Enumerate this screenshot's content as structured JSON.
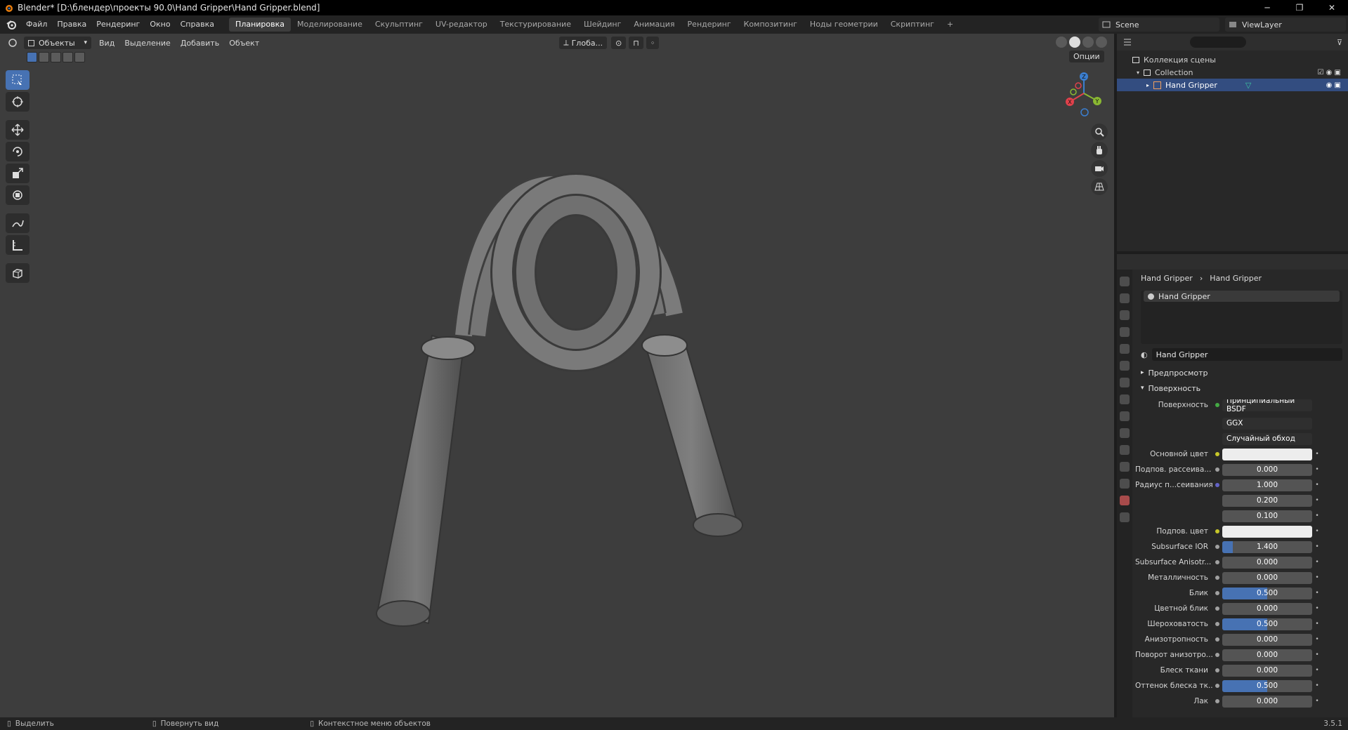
{
  "window": {
    "title": "Blender* [D:\\блендер\\проекты 90.0\\Hand Gripper\\Hand Gripper.blend]",
    "min_label": "─",
    "max_label": "❐",
    "close_label": "✕"
  },
  "menubar": {
    "items": [
      "Файл",
      "Правка",
      "Рендеринг",
      "Окно",
      "Справка"
    ],
    "workspaces": [
      "Планировка",
      "Моделирование",
      "Скульптинг",
      "UV-редактор",
      "Текстурирование",
      "Шейдинг",
      "Анимация",
      "Рендеринг",
      "Композитинг",
      "Ноды геометрии",
      "Скриптинг"
    ],
    "active_workspace": 0,
    "add_tab": "+",
    "scene": "Scene",
    "view_layer": "ViewLayer"
  },
  "viewport": {
    "mode": "Объекты",
    "menus": [
      "Вид",
      "Выделение",
      "Добавить",
      "Объект"
    ],
    "orientation": "Глоба...",
    "options": "Опции",
    "gizmo": {
      "x": "X",
      "y": "Y",
      "z": "Z"
    }
  },
  "outliner": {
    "rows": [
      {
        "label": "Коллекция сцены",
        "depth": 0,
        "selected": false
      },
      {
        "label": "Collection",
        "depth": 1,
        "selected": false
      },
      {
        "label": "Hand Gripper",
        "depth": 2,
        "selected": true
      }
    ]
  },
  "properties": {
    "breadcrumb": [
      "Hand Gripper",
      "Hand Gripper"
    ],
    "slot": "Hand Gripper",
    "material_name": "Hand Gripper",
    "panels": {
      "preview": "Предпросмотр",
      "surface": "Поверхность"
    },
    "surface_label": "Поверхность",
    "surface_value": "Принципиальный BSDF",
    "distribution": "GGX",
    "subsurface_method": "Случайный обход",
    "rows": [
      {
        "label": "Основной цвет",
        "value": "",
        "type": "color",
        "socket": "y"
      },
      {
        "label": "Подпов. рассеива...",
        "value": "0.000",
        "type": "num",
        "fill": 0,
        "socket": "g"
      },
      {
        "label": "Радиус п...сеивания",
        "value": "1.000",
        "type": "num",
        "fill": 0,
        "socket": "b"
      },
      {
        "label": "",
        "value": "0.200",
        "type": "num",
        "fill": 0,
        "socket": ""
      },
      {
        "label": "",
        "value": "0.100",
        "type": "num",
        "fill": 0,
        "socket": ""
      },
      {
        "label": "Подпов. цвет",
        "value": "",
        "type": "color",
        "socket": "y"
      },
      {
        "label": "Subsurface IOR",
        "value": "1.400",
        "type": "num",
        "fill": 0.12,
        "socket": "g"
      },
      {
        "label": "Subsurface Anisotr...",
        "value": "0.000",
        "type": "num",
        "fill": 0,
        "socket": "g"
      },
      {
        "label": "Металличность",
        "value": "0.000",
        "type": "num",
        "fill": 0,
        "socket": "g"
      },
      {
        "label": "Блик",
        "value": "0.500",
        "type": "num",
        "fill": 0.5,
        "socket": "g"
      },
      {
        "label": "Цветной блик",
        "value": "0.000",
        "type": "num",
        "fill": 0,
        "socket": "g"
      },
      {
        "label": "Шероховатость",
        "value": "0.500",
        "type": "num",
        "fill": 0.5,
        "socket": "g"
      },
      {
        "label": "Анизотропность",
        "value": "0.000",
        "type": "num",
        "fill": 0,
        "socket": "g"
      },
      {
        "label": "Поворот анизотро...",
        "value": "0.000",
        "type": "num",
        "fill": 0,
        "socket": "g"
      },
      {
        "label": "Блеск ткани",
        "value": "0.000",
        "type": "num",
        "fill": 0,
        "socket": "g"
      },
      {
        "label": "Оттенок блеска тк...",
        "value": "0.500",
        "type": "num",
        "fill": 0.5,
        "socket": "g"
      },
      {
        "label": "Лак",
        "value": "0.000",
        "type": "num",
        "fill": 0,
        "socket": "g"
      }
    ]
  },
  "statusbar": {
    "select": "Выделить",
    "rotate": "Повернуть вид",
    "context": "Контекстное меню объектов",
    "version": "3.5.1"
  }
}
